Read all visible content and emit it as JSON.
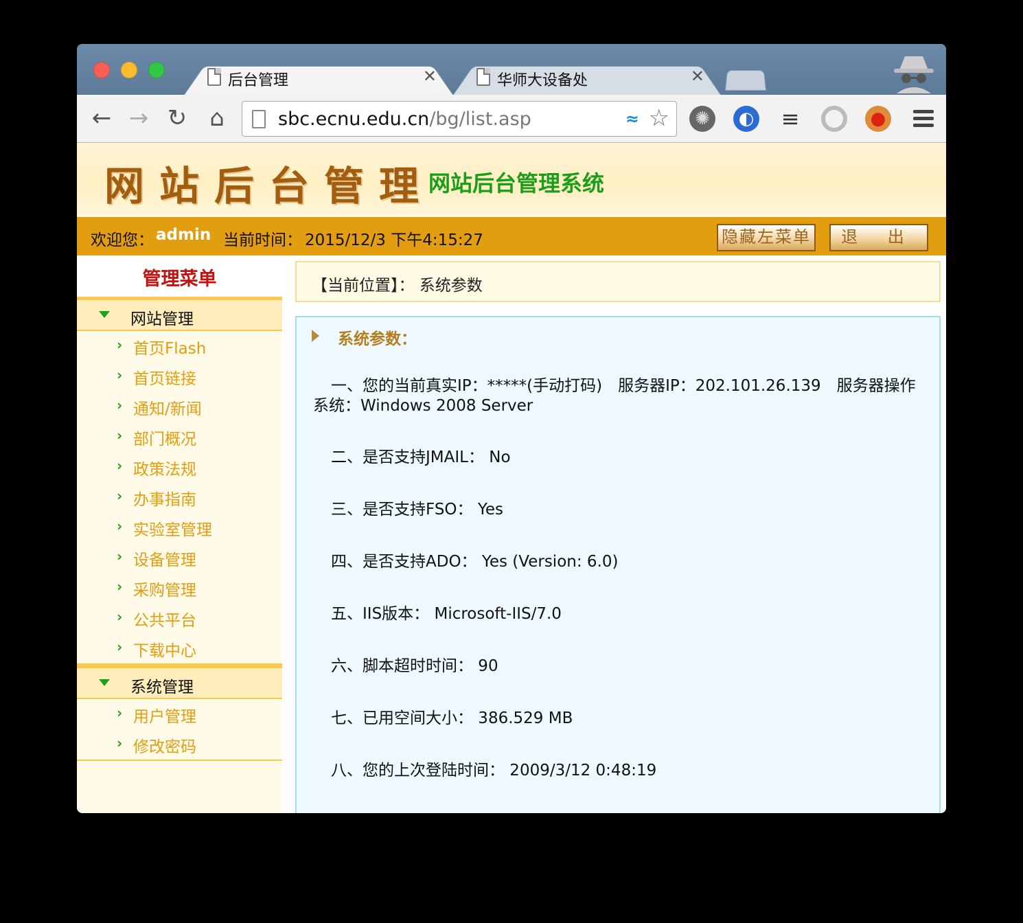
{
  "browser": {
    "tabs": [
      {
        "title": "后台管理",
        "active": true
      },
      {
        "title": "华师大设备处",
        "active": false
      }
    ],
    "url_host": "sbc.ecnu.edu.cn",
    "url_path": "/bg/list.asp"
  },
  "header": {
    "logo_text": "网站后台管理",
    "system_title": "网站后台管理系统"
  },
  "topbar": {
    "welcome_label": "欢迎您：",
    "username": "admin",
    "time_label": "当前时间：",
    "time_value": "2015/12/3 下午4:15:27",
    "hide_menu_button": "隐藏左菜单",
    "exit_button": "退 出"
  },
  "sidebar": {
    "title": "管理菜单",
    "groups": [
      {
        "title": "网站管理",
        "items": [
          "首页Flash",
          "首页链接",
          "通知/新闻",
          "部门概况",
          "政策法规",
          "办事指南",
          "实验室管理",
          "设备管理",
          "采购管理",
          "公共平台",
          "下载中心"
        ]
      },
      {
        "title": "系统管理",
        "items": [
          "用户管理",
          "修改密码"
        ]
      }
    ]
  },
  "location": {
    "text": "【当前位置】： 系统参数"
  },
  "content": {
    "heading": "系统参数：",
    "lines": [
      "一、您的当前真实IP：*****(手动打码)　服务器IP：202.101.26.139　服务器操作系统：Windows 2008 Server",
      "二、是否支持JMAIL： No",
      "三、是否支持FSO： Yes",
      "四、是否支持ADO： Yes (Version: 6.0)",
      "五、IIS版本： Microsoft-IIS/7.0",
      "六、脚本超时时间： 90",
      "七、已用空间大小： 386.529 MB",
      "八、您的上次登陆时间： 2009/3/12 0:48:19"
    ]
  },
  "colors": {
    "topbar": "#e29d11",
    "menu_title": "#c4120f",
    "menu_item": "#e29d11",
    "system_title": "#1a9e1a"
  },
  "icons": [
    "back-icon",
    "forward-icon",
    "reload-icon",
    "home-icon",
    "bookmark-star-icon",
    "incognito-icon",
    "menu-icon"
  ]
}
